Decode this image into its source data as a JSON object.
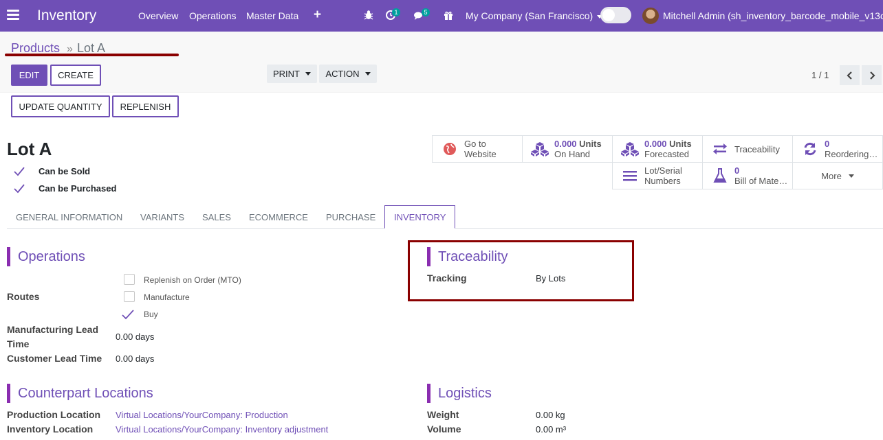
{
  "navbar": {
    "app_title": "Inventory",
    "menu": [
      "Overview",
      "Operations",
      "Master Data"
    ],
    "plus": "+",
    "activity_count": "1",
    "message_count": "5",
    "company": "My Company (San Francisco)",
    "user": "Mitchell Admin (sh_inventory_barcode_mobile_v13c)",
    "icons": [
      "menu-icon",
      "bug-icon",
      "clock-icon",
      "chat-icon",
      "gift-icon"
    ]
  },
  "breadcrumb": {
    "parent": "Products",
    "separator": "»",
    "current": "Lot A"
  },
  "toolbar": {
    "edit": "EDIT",
    "create": "CREATE",
    "print": "PRINT",
    "action": "ACTION",
    "pager": "1 / 1",
    "update_quantity": "UPDATE QUANTITY",
    "replenish": "REPLENISH"
  },
  "product": {
    "name": "Lot A",
    "can_be_sold": "Can be Sold",
    "can_be_purchased": "Can be Purchased"
  },
  "stat_buttons": {
    "website_line1": "Go to",
    "website_line2": "Website",
    "on_hand_num": "0.000",
    "on_hand_unit": "Units",
    "on_hand_label": "On Hand",
    "forecast_num": "0.000",
    "forecast_unit": "Units",
    "forecast_label": "Forecasted",
    "traceability": "Traceability",
    "reordering_num": "0",
    "reordering_label": "Reordering…",
    "lots_line1": "Lot/Serial",
    "lots_line2": "Numbers",
    "bom_num": "0",
    "bom_label": "Bill of Mate…",
    "more": "More"
  },
  "tabs": [
    "GENERAL INFORMATION",
    "VARIANTS",
    "SALES",
    "ECOMMERCE",
    "PURCHASE",
    "INVENTORY"
  ],
  "operations": {
    "title": "Operations",
    "routes_label": "Routes",
    "routes": [
      "Replenish on Order (MTO)",
      "Manufacture",
      "Buy"
    ],
    "manufacturing_lead_label_1": "Manufacturing Lead",
    "manufacturing_lead_label_2": "Time",
    "manufacturing_lead_value": "0.00 days",
    "customer_lead_label": "Customer Lead Time",
    "customer_lead_value": "0.00 days"
  },
  "traceability": {
    "title": "Traceability",
    "tracking_label": "Tracking",
    "tracking_value": "By Lots"
  },
  "counterpart": {
    "title": "Counterpart Locations",
    "production_label": "Production Location",
    "production_value": "Virtual Locations/YourCompany: Production",
    "inventory_label": "Inventory Location",
    "inventory_value": "Virtual Locations/YourCompany: Inventory adjustment"
  },
  "logistics": {
    "title": "Logistics",
    "weight_label": "Weight",
    "weight_value": "0.00 kg",
    "volume_label": "Volume",
    "volume_value": "0.00 m³"
  },
  "colors": {
    "brand": "#6f4fb6",
    "annotation": "#8a0000",
    "group_bar": "#8a2db0"
  }
}
